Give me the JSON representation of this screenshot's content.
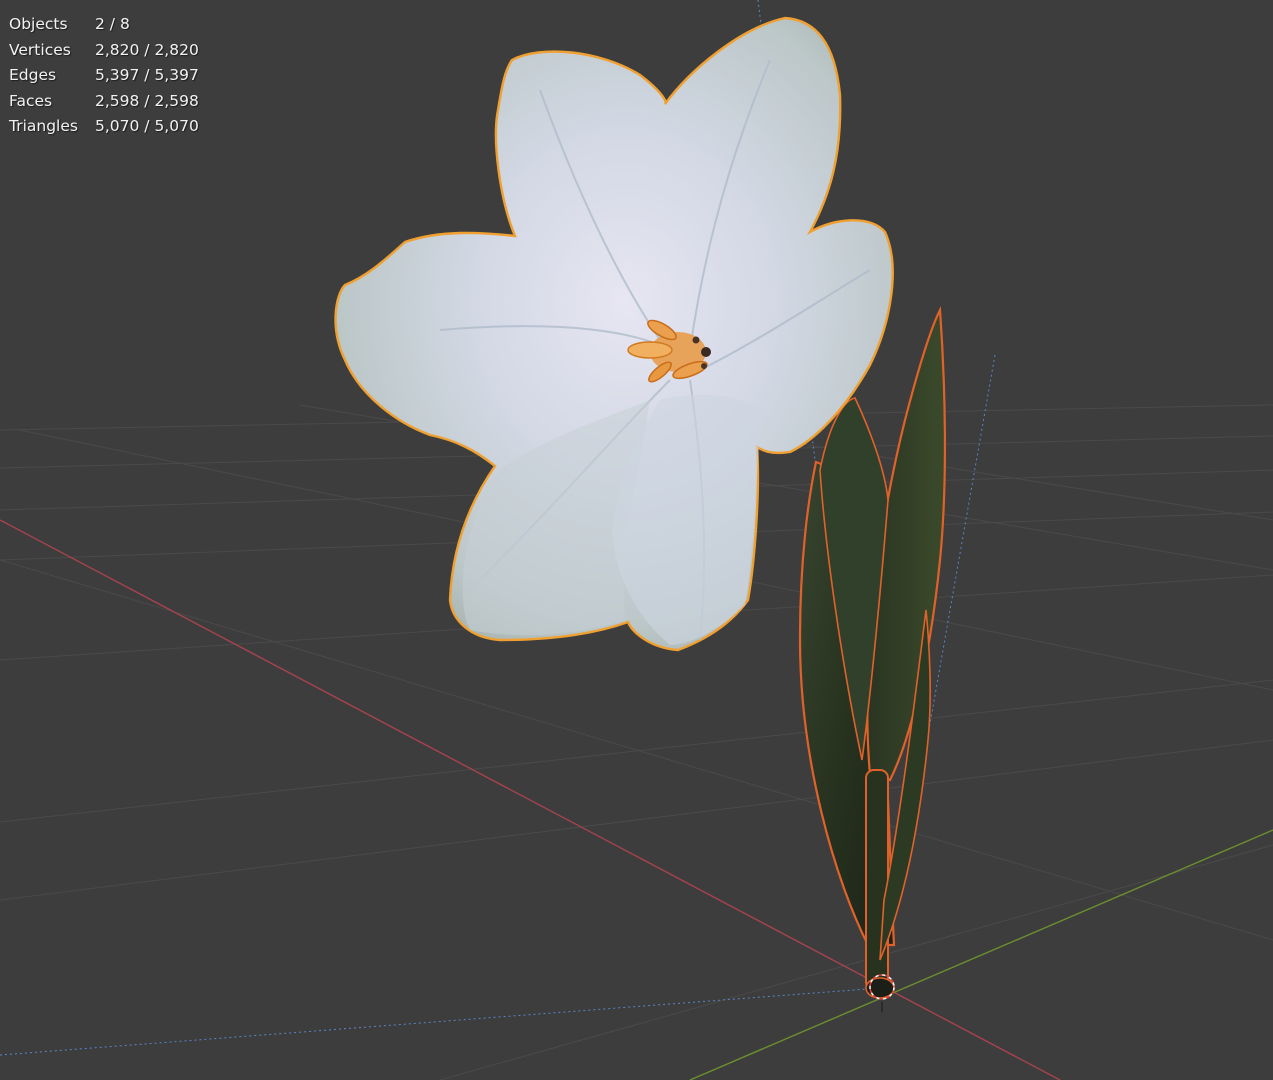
{
  "stats": [
    {
      "label": "Objects",
      "value": "2 / 8"
    },
    {
      "label": "Vertices",
      "value": "2,820 / 2,820"
    },
    {
      "label": "Edges",
      "value": "5,397 / 5,397"
    },
    {
      "label": "Faces",
      "value": "2,598 / 2,598"
    },
    {
      "label": "Triangles",
      "value": "5,070 / 5,070"
    }
  ],
  "colors": {
    "background": "#3d3d3d",
    "grid": "#4a4a4a",
    "x_axis": "#a6434f",
    "y_axis": "#6d8f2e",
    "z_axis": "#5a86c9",
    "active_outline": "#f0a030",
    "selected_outline": "#e0622a",
    "petal": "#d6dbe6",
    "leaf": "#2f3d29"
  }
}
